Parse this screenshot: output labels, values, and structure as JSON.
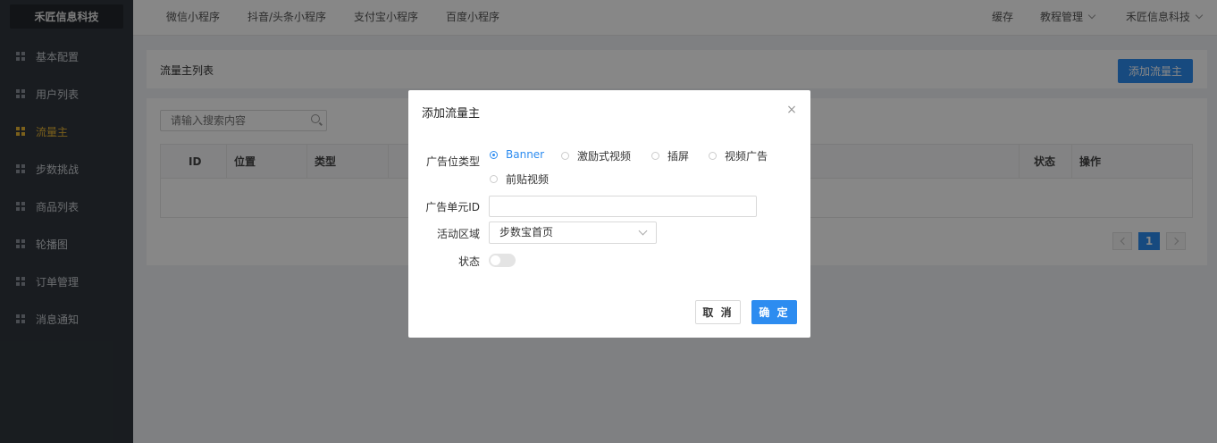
{
  "app": {
    "logo": "禾匠信息科技"
  },
  "sidebar": {
    "items": [
      {
        "label": "基本配置",
        "active": false
      },
      {
        "label": "用户列表",
        "active": false
      },
      {
        "label": "流量主",
        "active": true
      },
      {
        "label": "步数挑战",
        "active": false
      },
      {
        "label": "商品列表",
        "active": false
      },
      {
        "label": "轮播图",
        "active": false
      },
      {
        "label": "订单管理",
        "active": false
      },
      {
        "label": "消息通知",
        "active": false
      }
    ]
  },
  "header": {
    "tabs": [
      "微信小程序",
      "抖音/头条小程序",
      "支付宝小程序",
      "百度小程序"
    ],
    "cache": "缓存",
    "tutorial": "教程管理",
    "account": "禾匠信息科技"
  },
  "page": {
    "title": "流量主列表",
    "add_button": "添加流量主",
    "search_placeholder": "请输入搜索内容",
    "table_headers": [
      "ID",
      "位置",
      "类型",
      "状态",
      "操作"
    ],
    "current_page": "1"
  },
  "modal": {
    "title": "添加流量主",
    "close": "×",
    "ad_type_label": "广告位类型",
    "ad_types": [
      "Banner",
      "激励式视频",
      "插屏",
      "视频广告",
      "前贴视频"
    ],
    "ad_type_selected": "Banner",
    "unit_id_label": "广告单元ID",
    "unit_id_value": "",
    "region_label": "活动区域",
    "region_value": "步数宝首页",
    "status_label": "状态",
    "status_on": false,
    "cancel": "取 消",
    "confirm": "确 定"
  },
  "colors": {
    "accent": "#2d8cf0",
    "sidebar_bg": "#30363d",
    "active_nav": "#e8b634"
  }
}
